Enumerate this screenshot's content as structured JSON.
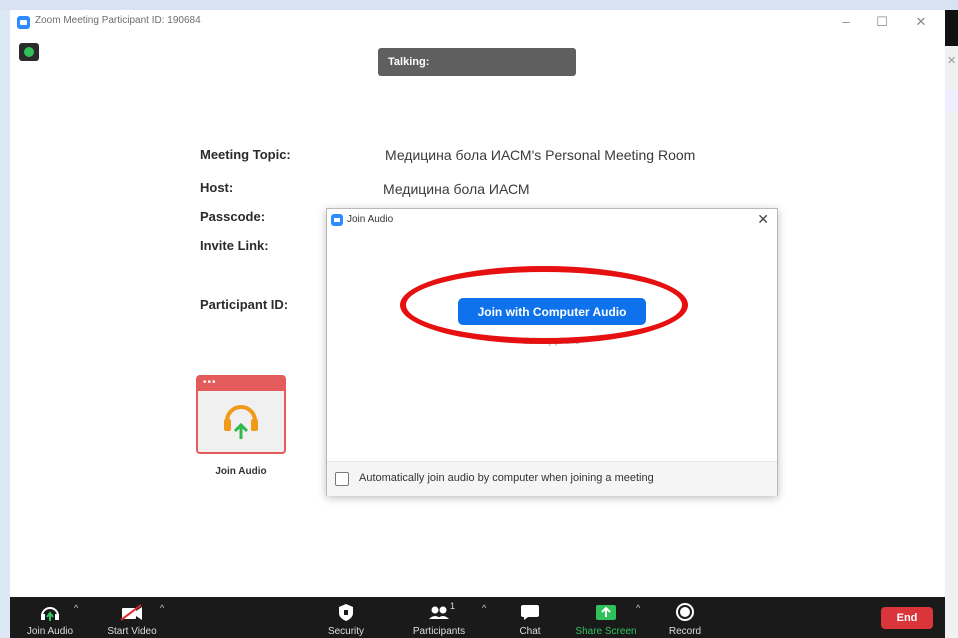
{
  "window": {
    "title": "Zoom Meeting Participant ID: 190684",
    "minimize": "–",
    "maximize": "☐",
    "close": "✕"
  },
  "banner": {
    "talking": "Talking:"
  },
  "meeting_info": {
    "topic_label": "Meeting Topic:",
    "topic_value": "Медицина бола ИАСМ's Personal Meeting Room",
    "host_label": "Host:",
    "host_value": "Медицина бола ИАСМ",
    "passcode_label": "Passcode:",
    "invite_label": "Invite Link:",
    "participant_id_label": "Participant ID:"
  },
  "join_audio_card": {
    "dots": "•••",
    "label": "Join Audio"
  },
  "dialog": {
    "title": "Join Audio",
    "close": "✕",
    "join_button": "Join with Computer Audio",
    "phone_link": "Join by phone",
    "checkbox_label": "Automatically join audio by computer when joining a meeting"
  },
  "toolbar": {
    "join_audio": "Join Audio",
    "start_video": "Start Video",
    "security": "Security",
    "participants": "Participants",
    "participants_count": "1",
    "chat": "Chat",
    "share_screen": "Share Screen",
    "record": "Record",
    "end": "End",
    "caret": "^"
  },
  "colors": {
    "accent_blue": "#0e72ed",
    "end_red": "#d9353a",
    "share_green": "#2fc25b",
    "annotation_red": "#e61010"
  }
}
